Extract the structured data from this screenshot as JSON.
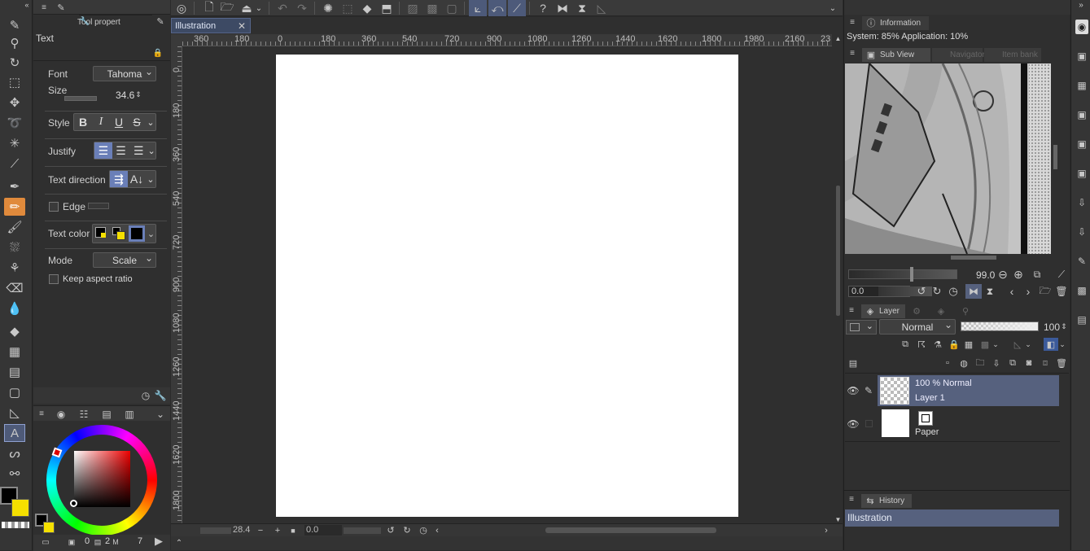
{
  "tool_property": {
    "tab_label": "Tool propert",
    "tool_name": "Text",
    "font_label": "Font",
    "font_value": "Tahoma",
    "size_label": "Size",
    "size_value": "34.6",
    "style_label": "Style",
    "justify_label": "Justify",
    "text_direction_label": "Text direction",
    "edge_label": "Edge",
    "text_color_label": "Text color",
    "mode_label": "Mode",
    "mode_value": "Scale",
    "keep_aspect_label": "Keep aspect ratio"
  },
  "color_panel": {
    "counter_a": "0",
    "counter_b": "2",
    "counter_c": "7",
    "main_color": "#000000",
    "sub_color": "#f5e000"
  },
  "canvas": {
    "document_tab": "Illustration",
    "ruler_h": [
      "360",
      "180",
      "0",
      "180",
      "360",
      "540",
      "720",
      "900",
      "1080",
      "1260",
      "1440",
      "1620",
      "1800",
      "1980",
      "2160",
      "23"
    ],
    "ruler_v": [
      "0",
      "180",
      "360",
      "540",
      "720",
      "900",
      "1080",
      "1260",
      "1440",
      "1620",
      "1800",
      "80"
    ],
    "zoom_value": "28.4",
    "rotation_value": "0.0"
  },
  "information": {
    "tab_label": "Information",
    "system_text": "System: 85%  Application: 10%"
  },
  "subview": {
    "tab_label": "Sub View",
    "tab_navigator": "Navigator",
    "tab_itembank": "Item bank",
    "zoom_value": "99.0",
    "angle_value": "0.0"
  },
  "layer_panel": {
    "tab_label": "Layer",
    "blend_mode": "Normal",
    "opacity": "100",
    "layers": [
      {
        "info": "100 % Normal",
        "name": "Layer 1"
      },
      {
        "info": "",
        "name": "Paper"
      }
    ]
  },
  "history": {
    "tab_label": "History",
    "items": [
      "Illustration"
    ]
  },
  "colors": {
    "accent": "#56617e",
    "active_tool": "#e08a3c",
    "selected_button": "#6a7fb8"
  }
}
